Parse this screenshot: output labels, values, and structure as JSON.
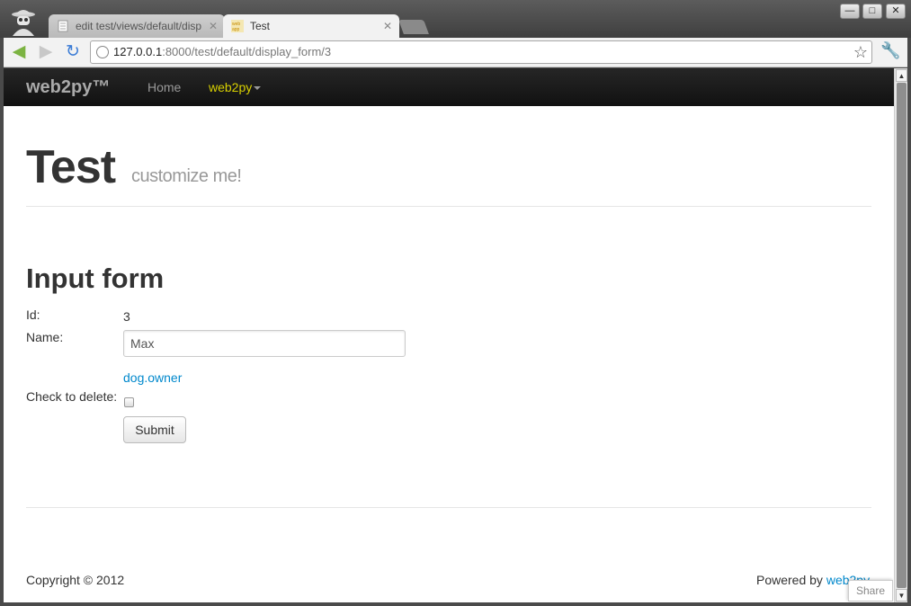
{
  "browser": {
    "tabs": [
      {
        "label": "edit test/views/default/disp",
        "active": false
      },
      {
        "label": "Test",
        "active": true
      }
    ],
    "window_buttons": [
      "—",
      "□",
      "✕"
    ],
    "url_host": "127.0.0.1",
    "url_rest": ":8000/test/default/display_form/3"
  },
  "navbar": {
    "brand": "web2py™",
    "home": "Home",
    "web2py_menu": "web2py"
  },
  "header": {
    "title": "Test",
    "subtitle": "customize me!"
  },
  "form": {
    "title": "Input form",
    "id_label": "Id:",
    "id_value": "3",
    "name_label": "Name:",
    "name_value": "Max",
    "link": "dog.owner",
    "delete_label": "Check to delete:",
    "submit": "Submit"
  },
  "footer": {
    "copyright": "Copyright © 2012",
    "powered_prefix": "Powered by ",
    "powered_link": "web2py",
    "share": "Share"
  },
  "colors": {
    "link": "#0088cc",
    "active_nav": "#d8d000",
    "navbar_bg": "#1b1b1b"
  }
}
